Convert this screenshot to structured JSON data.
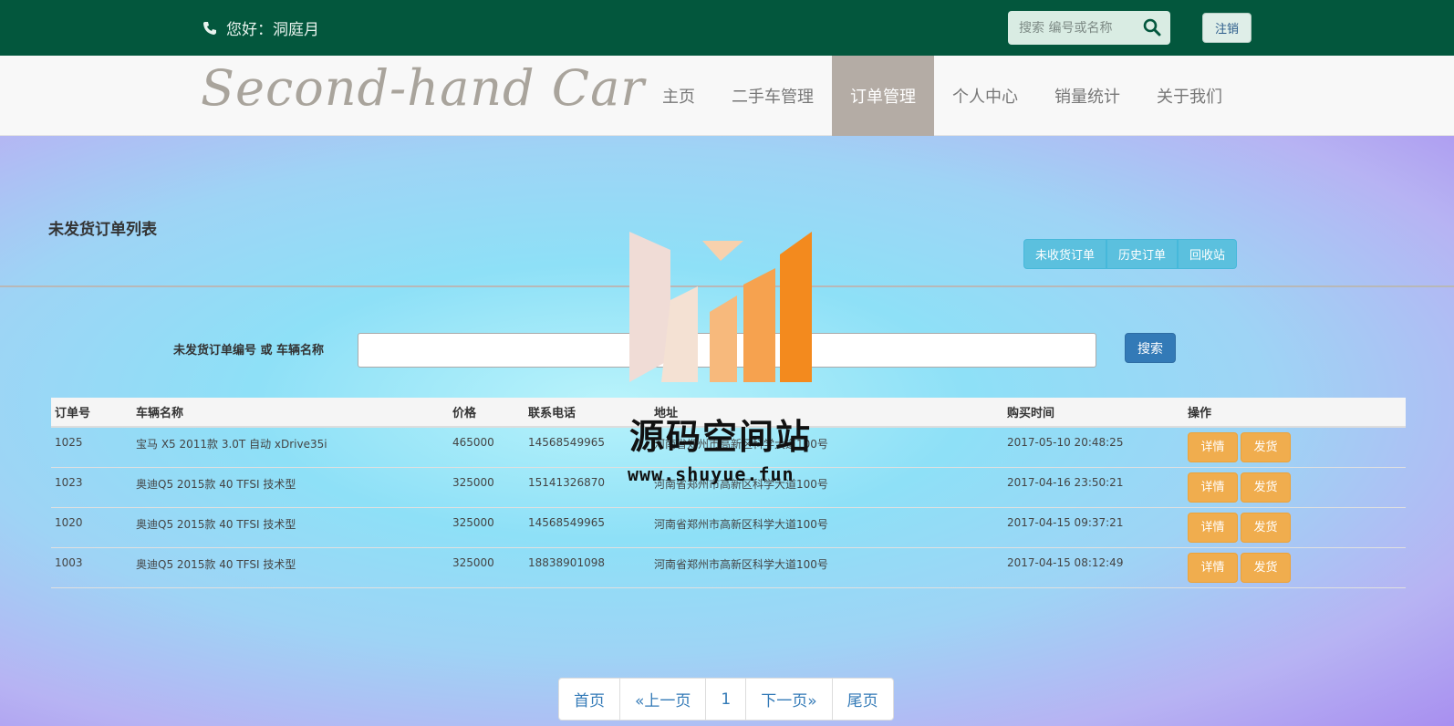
{
  "topbar": {
    "greeting": "您好：洞庭月",
    "search_placeholder": "搜索 编号或名称",
    "logout_label": "注销"
  },
  "navbar": {
    "logo": "Second-hand Car",
    "items": [
      {
        "label": "主页",
        "active": false
      },
      {
        "label": "二手车管理",
        "active": false
      },
      {
        "label": "订单管理",
        "active": true
      },
      {
        "label": "个人中心",
        "active": false
      },
      {
        "label": "销量统计",
        "active": false
      },
      {
        "label": "关于我们",
        "active": false
      }
    ]
  },
  "main": {
    "title": "未发货订单列表",
    "tabs": [
      "未收货订单",
      "历史订单",
      "回收站"
    ],
    "search": {
      "label": "未发货订单编号 或 车辆名称",
      "value": "",
      "button": "搜索"
    },
    "table": {
      "headers": [
        "订单号",
        "车辆名称",
        "价格",
        "联系电话",
        "地址",
        "购买时间",
        "操作"
      ],
      "rows": [
        {
          "id": "1025",
          "name": "宝马 X5 2011款 3.0T 自动 xDrive35i",
          "price": "465000",
          "phone": "14568549965",
          "address": "河南省郑州市高新区科学大道100号",
          "time": "2017-05-10 20:48:25"
        },
        {
          "id": "1023",
          "name": "奥迪Q5 2015款 40 TFSI 技术型",
          "price": "325000",
          "phone": "15141326870",
          "address": "河南省郑州市高新区科学大道100号",
          "time": "2017-04-16 23:50:21"
        },
        {
          "id": "1020",
          "name": "奥迪Q5 2015款 40 TFSI 技术型",
          "price": "325000",
          "phone": "14568549965",
          "address": "河南省郑州市高新区科学大道100号",
          "time": "2017-04-15 09:37:21"
        },
        {
          "id": "1003",
          "name": "奥迪Q5 2015款 40 TFSI 技术型",
          "price": "325000",
          "phone": "18838901098",
          "address": "河南省郑州市高新区科学大道100号",
          "time": "2017-04-15 08:12:49"
        }
      ],
      "op_detail": "详情",
      "op_ship": "发货"
    },
    "pagination": [
      "首页",
      "«上一页",
      "1",
      "下一页»",
      "尾页"
    ]
  },
  "watermark": {
    "title": "源码空间站",
    "url": "www.shuyue.fun"
  },
  "colors": {
    "topbar": "#03573d",
    "nav_active": "#b4aca5",
    "tab_info": "#5bc0de",
    "primary": "#337ab7",
    "warning": "#f0ad4e"
  }
}
